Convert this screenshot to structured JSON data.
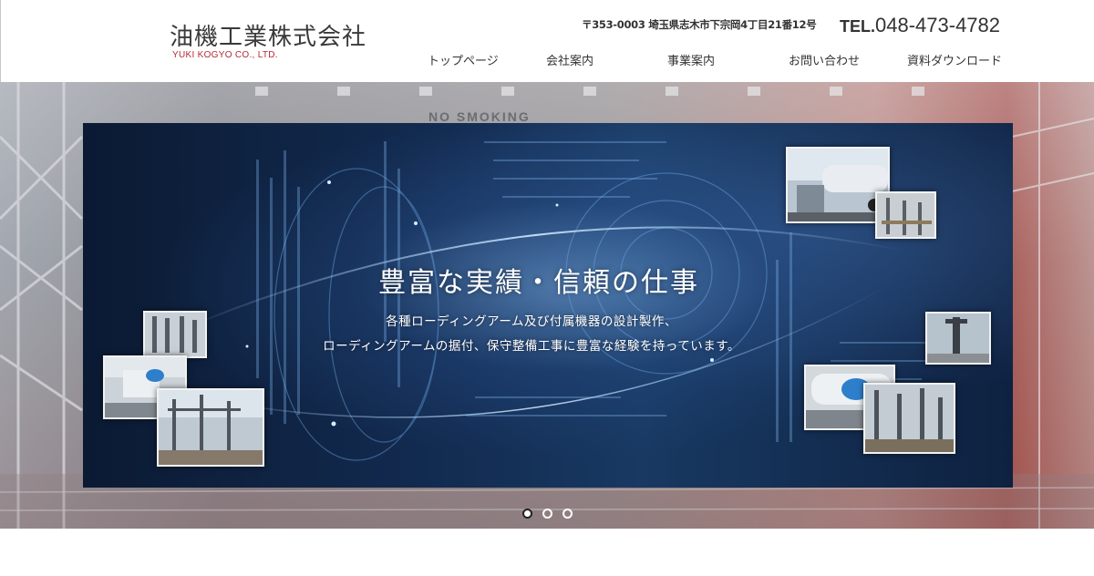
{
  "header": {
    "logo_jp": "油機工業株式会社",
    "logo_en": "YUKI KOGYO CO., LTD.",
    "address": "〒353-0003 埼玉県志木市下宗岡4丁目21番12号",
    "tel_prefix": "TEL.",
    "tel_number": "048-473-4782"
  },
  "nav": {
    "items": [
      {
        "label": "トップページ"
      },
      {
        "label": "会社案内"
      },
      {
        "label": "事業案内"
      },
      {
        "label": "お問い合わせ"
      },
      {
        "label": "資料ダウンロード"
      }
    ]
  },
  "hero": {
    "background_sign": "NO SMOKING",
    "slide": {
      "title": "豊富な実績・信頼の仕事",
      "line1": "各種ローディングアーム及び付属機器の設計製作、",
      "line2": "ローディングアームの据付、保守整備工事に豊富な経験を持っています。"
    },
    "pagination": {
      "count": 3,
      "active_index": 0
    }
  },
  "colors": {
    "logo_en_red": "#b42a33",
    "slide_bg": "#132c52",
    "text_dark": "#333333"
  }
}
